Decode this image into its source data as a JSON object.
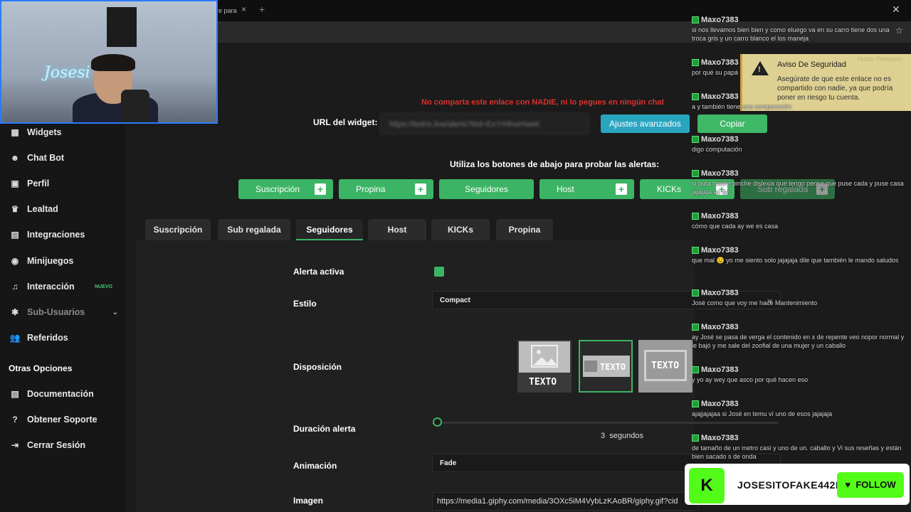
{
  "browser": {
    "tab_title": "re para",
    "tab_close": "×",
    "new_tab": "+",
    "window_close": "✕"
  },
  "sidebar": {
    "items": [
      {
        "label": "Widgets",
        "icon": "widgets-icon",
        "glyph": "▦"
      },
      {
        "label": "Chat Bot",
        "icon": "robot-icon",
        "glyph": "☻"
      },
      {
        "label": "Perfil",
        "icon": "profile-card-icon",
        "glyph": "▣"
      },
      {
        "label": "Lealtad",
        "icon": "trophy-icon",
        "glyph": "♛"
      },
      {
        "label": "Integraciones",
        "icon": "integrations-icon",
        "glyph": "▤"
      },
      {
        "label": "Minijuegos",
        "icon": "gamepad-icon",
        "glyph": "◉"
      },
      {
        "label": "Interacción",
        "icon": "music-note-icon",
        "glyph": "♫",
        "badge": "NUEVO"
      },
      {
        "label": "Sub-Usuarios",
        "icon": "users-icon",
        "glyph": "✱",
        "chevron": "⌄"
      },
      {
        "label": "Referidos",
        "icon": "referral-icon",
        "glyph": "👥"
      }
    ],
    "section_title": "Otras Opciones",
    "other_items": [
      {
        "label": "Documentación",
        "icon": "document-icon",
        "glyph": "▤"
      },
      {
        "label": "Obtener Soporte",
        "icon": "help-icon",
        "glyph": "?"
      },
      {
        "label": "Cerrar Sesión",
        "icon": "logout-icon",
        "glyph": "⇥"
      }
    ]
  },
  "main": {
    "warning": "No comparta este enlace con NADIE, ni lo pegues en ningún chat",
    "url_label": "URL del widget:",
    "url_value": "https://botrix.live/alerts?bid=ExYrHhwHweK",
    "advanced_button": "Ajustes avanzados",
    "copy_button": "Copiar",
    "test_label": "Utiliza los botones de abajo para probar las alertas:",
    "test_buttons": [
      "Suscripción",
      "Propina",
      "Seguidores",
      "Host",
      "KICKs",
      "Sub regalada"
    ],
    "plus": "+",
    "tabs": [
      "Suscripción",
      "Sub regalada",
      "Seguidores",
      "Host",
      "KICKs",
      "Propina"
    ],
    "active_tab": "Seguidores",
    "fields": {
      "alerta_activa": "Alerta activa",
      "estilo": "Estilo",
      "estilo_value": "Compact",
      "disposicion": "Disposición",
      "layout_text": "TEXTO",
      "duracion": "Duración alerta",
      "duracion_value": "3",
      "duracion_unit": "segundos",
      "animacion": "Animación",
      "animacion_value": "Fade",
      "imagen": "Imagen",
      "imagen_value": "https://media1.giphy.com/media/3OXc5iM4VybLzKAoBR/giphy.gif?cid"
    }
  },
  "webcam": {
    "neon_sign": "Josesi"
  },
  "security_popup": {
    "title": "Aviso De Seguridad",
    "text": "Asegúrate de que este enlace no es compartido con nadie, ya que podría poner en riesgo tu cuenta.",
    "premium": "Hazte Premium"
  },
  "chat": {
    "messages": [
      {
        "user": "Maxo7383",
        "text": "si nos llevamos bien bien y como eluego va en su carro tiene dos una troca gris y un carro blanco el los maneja"
      },
      {
        "user": "Maxo7383",
        "text": "por qué su papá"
      },
      {
        "user": "Maxo7383",
        "text": "a y también tiene una comparación"
      },
      {
        "user": "Maxo7383",
        "text": "digo computación"
      },
      {
        "user": "Maxo7383",
        "text": "si puta madre pinche dislexia que tengo pense que puse cada y puse casa jajajaja ay ay"
      },
      {
        "user": "Maxo7383",
        "text": "cómo que cada ay we es casa"
      },
      {
        "user": "Maxo7383",
        "text": "que mal 😉 yo me siento solo jajajaja dile que también le mando saludos"
      },
      {
        "user": "Maxo7383",
        "text": "José como que voy me hace Mantenimiento"
      },
      {
        "user": "Maxo7383",
        "text": "ay José se pasa de verga el contenido en x de repente veo nopor normal y le bajó y me sale del zoofial de una mujer y un caballo"
      },
      {
        "user": "Maxo7383",
        "text": "y yo ay wey que asco por qué hacen eso"
      },
      {
        "user": "Maxo7383",
        "text": "ajajjajajaa si José en temu ví uno de esos jajajaja"
      },
      {
        "user": "Maxo7383",
        "text": "de tamaño de un metro casi y uno de un. caballo y Vi sus reseñas y están bien sacado s de onda"
      }
    ]
  },
  "kick_banner": {
    "logo": "K",
    "channel": "JOSESITOFAKE442I",
    "follow": "FOLLOW",
    "heart": "♥"
  },
  "colors": {
    "accent_green": "#3cb465",
    "accent_blue": "#2aa5c0",
    "warning_red": "#d9322d",
    "kick_green": "#53fc18"
  }
}
